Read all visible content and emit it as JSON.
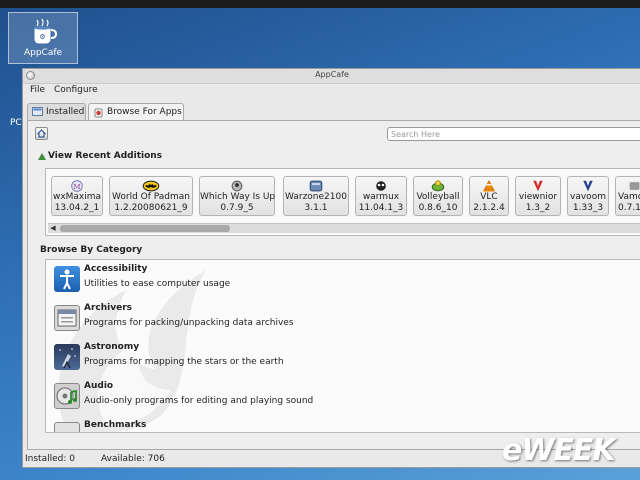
{
  "desktop": {
    "icon_label": "AppCafe",
    "side_label": "PC"
  },
  "window": {
    "title": "AppCafe"
  },
  "menu": {
    "file": "File",
    "configure": "Configure"
  },
  "tabs": [
    {
      "label": "Installed"
    },
    {
      "label": "Browse For Apps"
    }
  ],
  "search": {
    "placeholder": "Search Here"
  },
  "recent": {
    "heading": "View Recent Additions",
    "apps": [
      {
        "name": "wxMaxima",
        "version": "13.04.2_1",
        "icon": "wxmaxima-icon"
      },
      {
        "name": "World Of Padman",
        "version": "1.2.20080621_9",
        "icon": "batman-icon"
      },
      {
        "name": "Which Way Is Up",
        "version": "0.7.9_5",
        "icon": "which-way-icon"
      },
      {
        "name": "Warzone2100",
        "version": "3.1.1",
        "icon": "warzone-icon"
      },
      {
        "name": "warmux",
        "version": "11.04.1_3",
        "icon": "warmux-icon"
      },
      {
        "name": "Volleyball",
        "version": "0.8.6_10",
        "icon": "volleyball-icon"
      },
      {
        "name": "VLC",
        "version": "2.1.2.4",
        "icon": "vlc-cone-icon"
      },
      {
        "name": "viewnior",
        "version": "1.3_2",
        "icon": "viewnior-icon"
      },
      {
        "name": "vavoom",
        "version": "1.33_3",
        "icon": "vavoom-icon"
      },
      {
        "name": "Vamc",
        "version": "0.7.1",
        "icon": "vamc-icon"
      }
    ]
  },
  "categories": {
    "heading": "Browse By Category",
    "items": [
      {
        "name": "Accessibility",
        "desc": "Utilities to ease computer usage",
        "icon": "accessibility-icon"
      },
      {
        "name": "Archivers",
        "desc": "Programs for packing/unpacking data archives",
        "icon": "archiver-icon"
      },
      {
        "name": "Astronomy",
        "desc": "Programs for mapping the stars or the earth",
        "icon": "astronomy-icon"
      },
      {
        "name": "Audio",
        "desc": "Audio-only programs for editing and playing sound",
        "icon": "audio-icon"
      },
      {
        "name": "Benchmarks",
        "desc": "",
        "icon": "benchmarks-icon"
      }
    ]
  },
  "status": {
    "installed": "Installed: 0",
    "available": "Available: 706"
  },
  "watermark": {
    "text": "eWEEK"
  }
}
